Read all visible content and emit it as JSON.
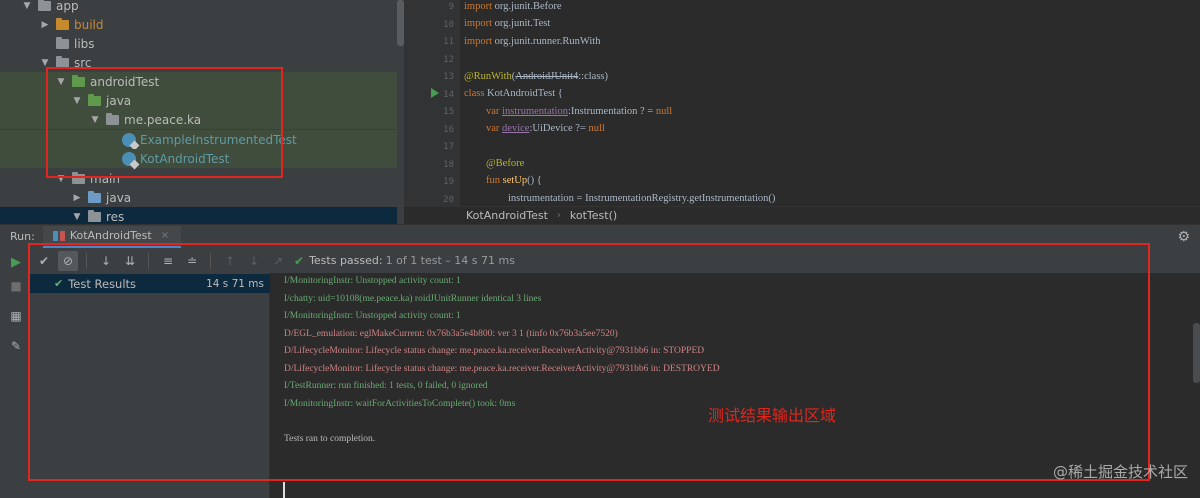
{
  "project_tree": {
    "items": [
      {
        "label": "app",
        "kind": "module"
      },
      {
        "label": "build",
        "kind": "folder"
      },
      {
        "label": "libs",
        "kind": "folder"
      },
      {
        "label": "src",
        "kind": "folder"
      },
      {
        "label": "androidTest",
        "kind": "folder"
      },
      {
        "label": "java",
        "kind": "folder"
      },
      {
        "label": "me.peace.ka",
        "kind": "package"
      },
      {
        "label": "ExampleInstrumentedTest",
        "kind": "class"
      },
      {
        "label": "KotAndroidTest",
        "kind": "class"
      },
      {
        "label": "main",
        "kind": "folder"
      },
      {
        "label": "java",
        "kind": "folder"
      },
      {
        "label": "res",
        "kind": "folder"
      }
    ]
  },
  "editor": {
    "line_numbers": [
      "9",
      "10",
      "11",
      "12",
      "13",
      "14",
      "15",
      "16",
      "17",
      "18",
      "19",
      "20"
    ],
    "lines": {
      "l9_kw": "import",
      "l9_rest": " org.junit.",
      "l9_cls": "Before",
      "l10_kw": "import",
      "l10_rest": " org.junit.",
      "l10_cls": "Test",
      "l11_kw": "import",
      "l11_rest": " org.junit.runner.",
      "l11_cls": "RunWith",
      "l13_ann": "@RunWith",
      "l13_open": "(",
      "l13_strike": "AndroidJUnit4",
      "l13_rest": "::class)",
      "l14_kw": "class",
      "l14_rest": " KotAndroidTest {",
      "l15_kw": "var",
      "l15_field": "instrumentation",
      "l15_rest": ":Instrumentation ? = ",
      "l15_null": "null",
      "l16_kw": "var",
      "l16_field": "device",
      "l16_rest": ":UiDevice ?= ",
      "l16_null": "null",
      "l18_ann": "@Before",
      "l19_kw": "fun",
      "l19_fn": "setUp",
      "l19_rest": "() {",
      "l20_text": "instrumentation = InstrumentationRegistry.getInstrumentation()"
    },
    "breadcrumb": {
      "class_name": "KotAndroidTest",
      "separator": "›",
      "method": "kotTest()"
    }
  },
  "run_window": {
    "label": "Run:",
    "tab_title": "KotAndroidTest",
    "tab_close": "×",
    "status": {
      "text": "Tests passed: ",
      "count": "1 of 1 test – 14 s 71 ms"
    },
    "test_results": {
      "label": "Test Results",
      "time": "14 s 71 ms"
    }
  },
  "console_lines": [
    {
      "text": "I/MonitoringInstr: Unstopped activity count: 1",
      "level": "info"
    },
    {
      "text": "I/chatty: uid=10108(me.peace.ka) roidJUnitRunner identical 3 lines",
      "level": "info"
    },
    {
      "text": "I/MonitoringInstr: Unstopped activity count: 1",
      "level": "info"
    },
    {
      "text": "D/EGL_emulation: eglMakeCurrent: 0x76b3a5e4b800: ver 3 1 (tinfo 0x76b3a5ee7520)",
      "level": "debug"
    },
    {
      "text": "D/LifecycleMonitor: Lifecycle status change: me.peace.ka.receiver.ReceiverActivity@7931bb6 in: STOPPED",
      "level": "debug"
    },
    {
      "text": "D/LifecycleMonitor: Lifecycle status change: me.peace.ka.receiver.ReceiverActivity@7931bb6 in: DESTROYED",
      "level": "debug"
    },
    {
      "text": "I/TestRunner: run finished: 1 tests, 0 failed, 0 ignored",
      "level": "info"
    },
    {
      "text": "I/MonitoringInstr: waitForActivitiesToComplete() took: 0ms",
      "level": "info"
    },
    {
      "text": "",
      "level": "plain"
    },
    {
      "text": "Tests ran to completion.",
      "level": "plain"
    }
  ],
  "annotation": "测试结果输出区域",
  "watermark": "@稀土掘金技术社区",
  "icons": {
    "rerun": "play-icon",
    "stop": "stop-icon",
    "layout": "layout-icon",
    "pin": "pin-icon",
    "show_passed": "check-icon",
    "show_ignored": "ignored-icon",
    "sort_alpha": "sort-alpha-icon",
    "sort_duration": "sort-duration-icon",
    "expand": "expand-all-icon",
    "collapse": "collapse-all-icon",
    "prev": "up-arrow-icon",
    "next": "down-arrow-icon",
    "export": "export-icon",
    "settings": "gear-icon"
  },
  "colors": {
    "annotation_red": "#e0261e",
    "pass_green": "#499c54",
    "selection": "#0d293e"
  }
}
